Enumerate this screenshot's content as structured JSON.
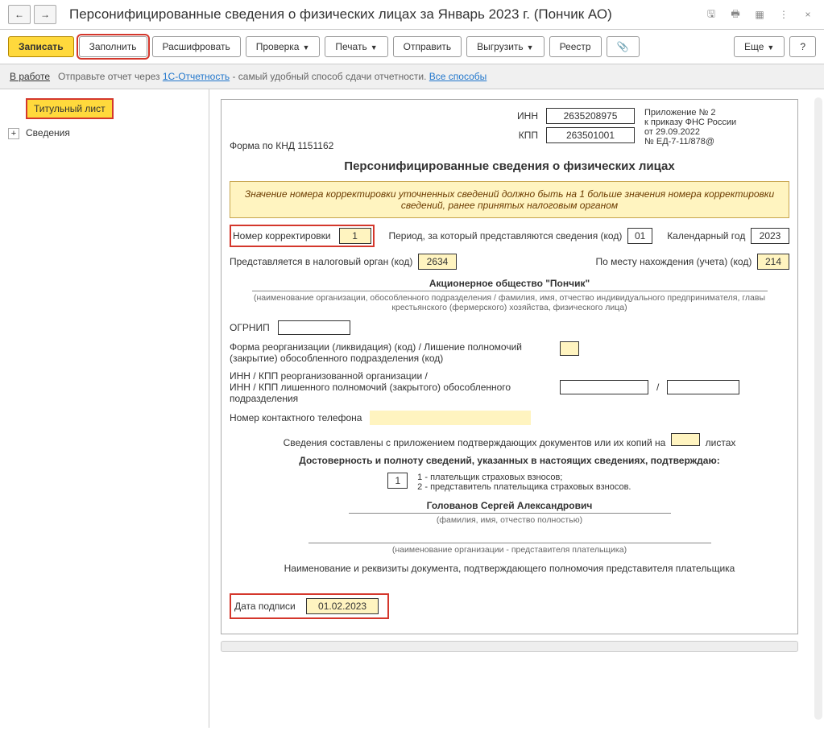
{
  "titlebar": {
    "back": "←",
    "fwd": "→",
    "title": "Персонифицированные сведения о физических лицах за Январь 2023 г. (Пончик АО)",
    "close": "×"
  },
  "toolbar": {
    "save": "Записать",
    "fill": "Заполнить",
    "decode": "Расшифровать",
    "check": "Проверка",
    "print": "Печать",
    "send": "Отправить",
    "export": "Выгрузить",
    "registry": "Реестр",
    "more": "Еще",
    "help": "?"
  },
  "infobar": {
    "status": "В работе",
    "msg1": "Отправьте отчет через ",
    "link1": "1С-Отчетность",
    "msg2": " - самый удобный способ сдачи отчетности. ",
    "link2": "Все способы"
  },
  "sidebar": {
    "title_page": "Титульный лист",
    "details": "Сведения"
  },
  "form": {
    "knd": "Форма по КНД 1151162",
    "inn_lbl": "ИНН",
    "inn_val": "2635208975",
    "kpp_lbl": "КПП",
    "kpp_val": "263501001",
    "appendix": "Приложение № 2\nк приказу ФНС России\nот 29.09.2022\n№ ЕД-7-11/878@",
    "main_title": "Персонифицированные сведения о физических лицах",
    "notice": "Значение номера корректировки уточненных сведений должно быть на 1 больше значения номера корректировки сведений, ранее принятых налоговым органом",
    "corr_lbl": "Номер корректировки",
    "corr_val": "1",
    "period_lbl": "Период, за который представляются сведения (код)",
    "period_val": "01",
    "year_lbl": "Календарный год",
    "year_val": "2023",
    "tax_lbl": "Представляется в налоговый орган (код)",
    "tax_val": "2634",
    "place_lbl": "По месту нахождения (учета) (код)",
    "place_val": "214",
    "org_name": "Акционерное общество \"Пончик\"",
    "org_note": "(наименование организации, обособленного подразделения / фамилия, имя, отчество индивидуального предпринимателя, главы крестьянского (фермерского) хозяйства, физического лица)",
    "ogrnip_lbl": "ОГРНИП",
    "reorg_lbl": "Форма реорганизации (ликвидация) (код) / Лишение полномочий (закрытие) обособленного подразделения (код)",
    "reorg2_lbl": "ИНН / КПП реорганизованной организации /\nИНН / КПП лишенного полномочий (закрытого) обособленного подразделения",
    "slash": "/",
    "phone_lbl": "Номер контактного телефона",
    "pages_lbl": "Сведения составлены с приложением подтверждающих документов или их копий на",
    "pages_suffix": "листах",
    "confirm_title": "Достоверность и полноту сведений, указанных в настоящих сведениях, подтверждаю:",
    "who_val": "1",
    "who_opts": "1 - плательщик страховых взносов;\n2 - представитель плательщика страховых взносов.",
    "fio": "Голованов Сергей Александрович",
    "fio_note": "(фамилия, имя, отчество полностью)",
    "repr_note": "(наименование организации - представителя плательщика)",
    "repr_doc": "Наименование и реквизиты документа, подтверждающего полномочия представителя плательщика",
    "sig_date_lbl": "Дата подписи",
    "sig_date_val": "01.02.2023"
  }
}
